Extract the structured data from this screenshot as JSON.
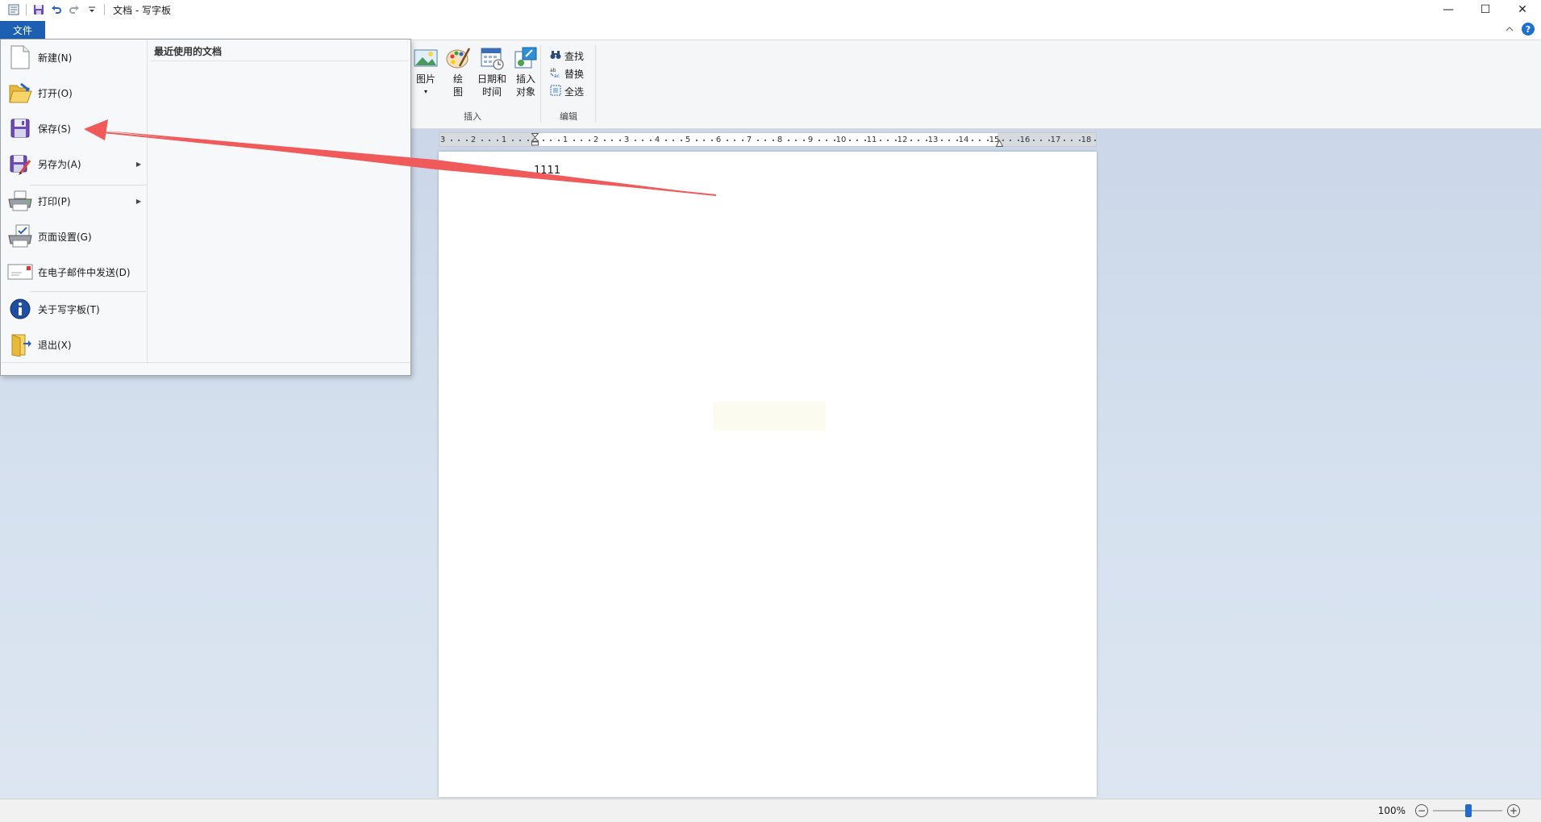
{
  "window": {
    "title": "文档 - 写字板",
    "controls": {
      "minimize": "—",
      "maximize": "☐",
      "close": "✕"
    }
  },
  "quick_access": [
    "save-icon",
    "undo-icon",
    "redo-icon",
    "customize-icon"
  ],
  "ribbon": {
    "file_tab": "文件",
    "help": "?",
    "insert_group": {
      "label": "插入",
      "buttons": [
        {
          "line1": "图片",
          "line2": "▾"
        },
        {
          "line1": "绘",
          "line2": "图"
        },
        {
          "line1": "日期和",
          "line2": "时间"
        },
        {
          "line1": "插入",
          "line2": "对象"
        }
      ]
    },
    "edit_group": {
      "label": "编辑",
      "buttons": [
        "查找",
        "替换",
        "全选"
      ]
    }
  },
  "ruler": {
    "ticks": [
      "3",
      "2",
      "1",
      "1",
      "2",
      "3",
      "4",
      "5",
      "6",
      "7",
      "8",
      "9",
      "10",
      "11",
      "12",
      "13",
      "14",
      "15",
      "16",
      "17",
      "18"
    ]
  },
  "document": {
    "text": "1111"
  },
  "file_menu": {
    "items": [
      {
        "label": "新建(N)"
      },
      {
        "label": "打开(O)"
      },
      {
        "label": "保存(S)"
      },
      {
        "label": "另存为(A)",
        "arrow": "▶"
      },
      {
        "label": "打印(P)",
        "arrow": "▶"
      },
      {
        "label": "页面设置(G)"
      },
      {
        "label": "在电子邮件中发送(D)"
      },
      {
        "label": "关于写字板(T)"
      },
      {
        "label": "退出(X)"
      }
    ],
    "recent_title": "最近使用的文档"
  },
  "statusbar": {
    "zoom": "100%",
    "zoom_out": "−",
    "zoom_in": "+"
  },
  "colors": {
    "file_tab": "#1c5fb3",
    "arrow": "#f05a5a",
    "zoom_thumb": "#1f6bd1"
  }
}
